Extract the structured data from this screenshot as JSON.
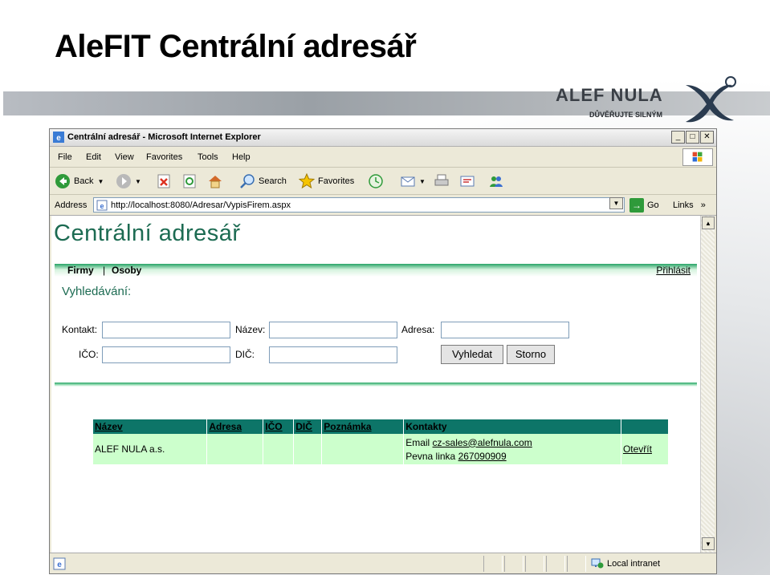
{
  "slide": {
    "title": "AleFIT Centrální adresář",
    "logo_text": "ALEF NULA",
    "logo_sub": "DŮVĚŘUJTE SILNÝM"
  },
  "browser": {
    "title": "Centrální adresář - Microsoft Internet Explorer",
    "menu": [
      "File",
      "Edit",
      "View",
      "Favorites",
      "Tools",
      "Help"
    ],
    "toolbar": {
      "back": "Back",
      "search": "Search",
      "favorites": "Favorites"
    },
    "address_label": "Address",
    "address_url": "http://localhost:8080/Adresar/VypisFirem.aspx",
    "go_label": "Go",
    "links_label": "Links",
    "links_chevron": "»",
    "status_zone": "Local intranet"
  },
  "page": {
    "heading": "Centrální adresář",
    "nav": {
      "firmy": "Firmy",
      "separator": "|",
      "osoby": "Osoby",
      "login": "Přihlásit"
    },
    "search": {
      "title": "Vyhledávání:",
      "kontakt_label": "Kontakt:",
      "nazev_label": "Název:",
      "adresa_label": "Adresa:",
      "ico_label": "IČO:",
      "dic_label": "DIČ:",
      "kontakt_value": "",
      "nazev_value": "",
      "adresa_value": "",
      "ico_value": "",
      "dic_value": "",
      "search_button": "Vyhledat",
      "cancel_button": "Storno"
    },
    "table": {
      "headers": [
        "Název",
        "Adresa",
        "IČO",
        "DIČ",
        "Poznámka",
        "Kontakty",
        ""
      ],
      "rows": [
        {
          "nazev": "ALEF NULA a.s.",
          "adresa": "",
          "ico": "",
          "dic": "",
          "poznamka": "",
          "email_label": "Email",
          "email": "cz-sales@alefnula.com",
          "phone_label": "Pevna linka",
          "phone": "267090909",
          "action": "Otevřít"
        }
      ]
    }
  }
}
